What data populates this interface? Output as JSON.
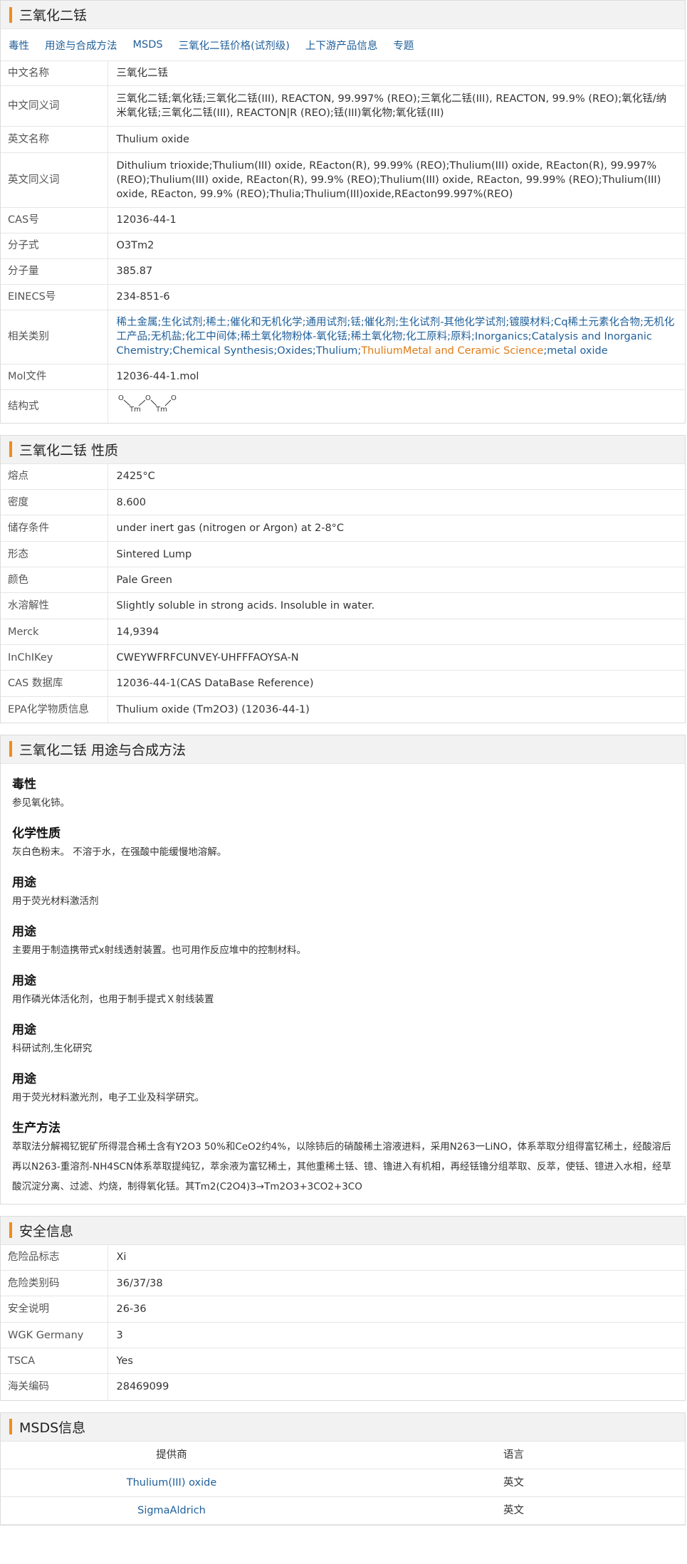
{
  "basic": {
    "header": "三氧化二铥",
    "nav": [
      "毒性",
      "用途与合成方法",
      "MSDS",
      "三氧化二铥价格(试剂级)",
      "上下游产品信息",
      "专题"
    ],
    "rows": [
      {
        "label": "中文名称",
        "value": "三氧化二铥"
      },
      {
        "label": "中文同义词",
        "value": "三氧化二铥;氧化铥;三氧化二铥(III), REACTON, 99.997% (REO);三氧化二铥(III), REACTON, 99.9% (REO);氧化铥/纳米氧化铥;三氧化二铥(III), REACTON|R (REO);铥(III)氧化物;氧化铥(III)"
      },
      {
        "label": "英文名称",
        "value": "Thulium oxide"
      },
      {
        "label": "英文同义词",
        "value": "Dithulium trioxide;Thulium(III) oxide, REacton(R), 99.99% (REO);Thulium(III) oxide, REacton(R), 99.997% (REO);Thulium(III) oxide, REacton(R), 99.9% (REO);Thulium(III) oxide, REacton, 99.99% (REO);Thulium(III) oxide, REacton, 99.9% (REO);Thulia;Thulium(III)oxide,REacton99.997%(REO)"
      },
      {
        "label": "CAS号",
        "value": "12036-44-1"
      },
      {
        "label": "分子式",
        "value": "O3Tm2"
      },
      {
        "label": "分子量",
        "value": "385.87"
      },
      {
        "label": "EINECS号",
        "value": "234-851-6"
      }
    ],
    "category_label": "相关类别",
    "category_blue": "稀土金属;生化试剂;稀土;催化和无机化学;通用试剂;铥;催化剂;生化试剂-其他化学试剂;镀膜材料;Cq稀土元素化合物;无机化工产品;无机盐;化工中间体;稀土氧化物粉体-氧化铥;稀土氧化物;化工原料;原料;Inorganics;Catalysis and Inorganic Chemistry;Chemical Synthesis;Oxides;Thulium;",
    "category_orange": "ThuliumMetal and Ceramic Science",
    "category_tail": ";metal oxide",
    "mol_label": "Mol文件",
    "mol_value": "12036-44-1.mol",
    "struct_label": "结构式",
    "struct_atoms": [
      "O",
      "Tm",
      "O",
      "Tm",
      "O"
    ]
  },
  "props": {
    "header": "三氧化二铥 性质",
    "rows": [
      {
        "label": "熔点",
        "value": "2425°C"
      },
      {
        "label": "密度",
        "value": "8.600"
      },
      {
        "label": "储存条件",
        "value": "under inert gas (nitrogen or Argon) at 2-8°C"
      },
      {
        "label": "形态",
        "value": "Sintered Lump"
      },
      {
        "label": "颜色",
        "value": "Pale Green"
      },
      {
        "label": "水溶解性",
        "value": "Slightly soluble in strong acids. Insoluble in water."
      },
      {
        "label": "Merck",
        "value": "14,9394"
      },
      {
        "label": "InChIKey",
        "value": "CWEYWFRFCUNVEY-UHFFFAOYSA-N"
      }
    ],
    "link_rows": [
      {
        "label": "CAS 数据库",
        "value": "12036-44-1(CAS DataBase Reference)"
      },
      {
        "label": "EPA化学物质信息",
        "value": "Thulium oxide (Tm2O3) (12036-44-1)"
      }
    ]
  },
  "usage": {
    "header": "三氧化二铥 用途与合成方法",
    "items": [
      {
        "h": "毒性",
        "p": "参见氧化铈。"
      },
      {
        "h": "化学性质",
        "p": "灰白色粉末。 不溶于水，在强酸中能缓慢地溶解。"
      },
      {
        "h": "用途",
        "p": "用于荧光材料激活剂"
      },
      {
        "h": "用途",
        "p": "主要用于制造携带式x射线透射装置。也可用作反应堆中的控制材料。"
      },
      {
        "h": "用途",
        "p": "用作磷光体活化剂，也用于制手提式Ｘ射线装置"
      },
      {
        "h": "用途",
        "p": "科研试剂,生化研究"
      },
      {
        "h": "用途",
        "p": "用于荧光材料激光剂，电子工业及科学研究。"
      },
      {
        "h": "生产方法",
        "p": "萃取法分解褐钇铌矿所得混合稀土含有Y2O3 50%和CeO2约4%，以除铈后的硝酸稀土溶液进料，采用N263一LiNO，体系萃取分组得富钇稀土，经酸溶后再以N263-重溶剂-NH4SCN体系萃取提纯钇，萃余液为富钇稀土，其他重稀土铥、镱、镥进入有机相，再经铥镥分组萃取、反萃，使铥、镱进入水相，经草酸沉淀分离、过滤、灼烧，制得氧化铥。其Tm2(C2O4)3→Tm2O3+3CO2+3CO"
      }
    ]
  },
  "safety": {
    "header": "安全信息",
    "rows": [
      {
        "label": "危险品标志",
        "value": "Xi",
        "link": true
      },
      {
        "label": "危险类别码",
        "value": "36/37/38",
        "link": true
      },
      {
        "label": "安全说明",
        "value": "26-36",
        "link": true
      },
      {
        "label": "WGK Germany",
        "value": "3",
        "link": false
      },
      {
        "label": "TSCA",
        "value": "Yes",
        "link": false
      },
      {
        "label": "海关编码",
        "value": "28469099",
        "link": false
      }
    ]
  },
  "msds": {
    "header": "MSDS信息",
    "col_provider": "提供商",
    "col_lang": "语言",
    "rows": [
      {
        "provider": "Thulium(III) oxide",
        "lang": "英文"
      },
      {
        "provider": "SigmaAldrich",
        "lang": "英文"
      }
    ]
  },
  "colors": {
    "accent": "#f08c1a",
    "link": "#1f5f99",
    "header_bg": "#f2f2f2"
  }
}
